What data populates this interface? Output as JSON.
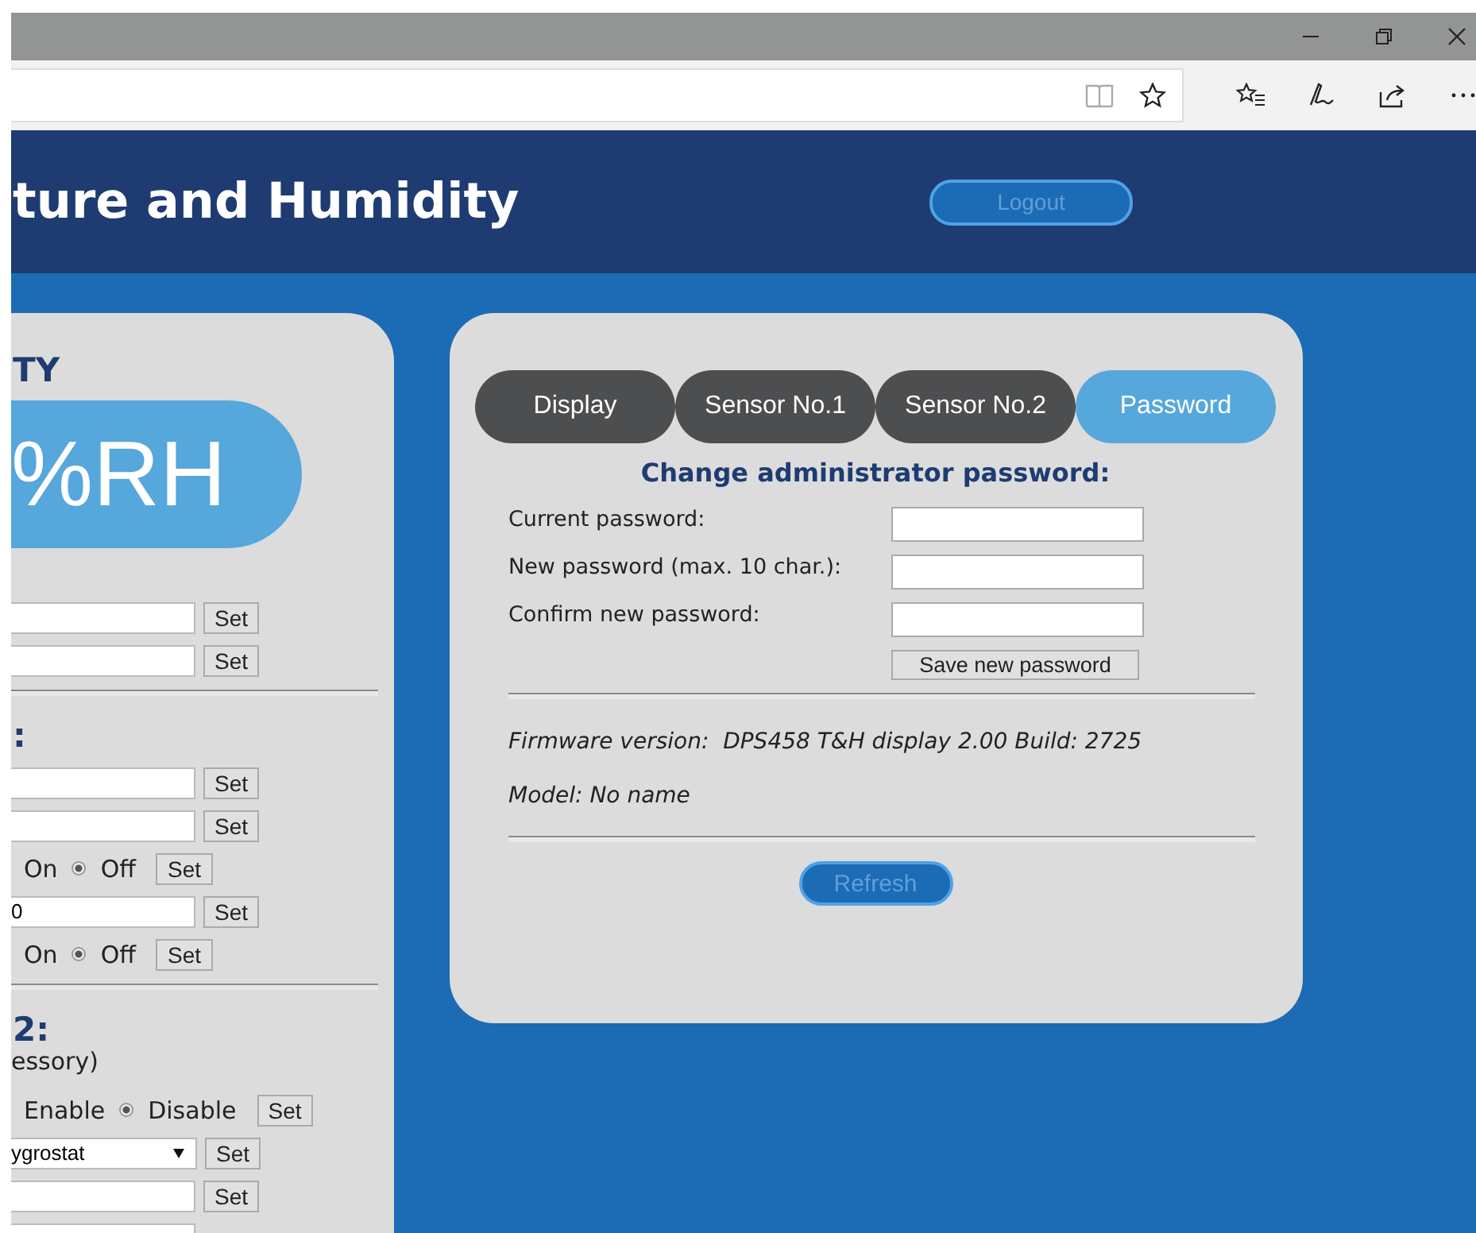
{
  "header": {
    "title": "ture and Humidity",
    "logout": "Logout"
  },
  "left_panel": {
    "rows": [
      {
        "kind": "heading",
        "text": "TY"
      },
      {
        "kind": "reading",
        "text": "%RH"
      },
      {
        "kind": "field",
        "button": "Set"
      },
      {
        "kind": "field",
        "button": "Set"
      },
      {
        "kind": "divider"
      },
      {
        "kind": "heading",
        "text": ":"
      },
      {
        "kind": "field",
        "button": "Set"
      },
      {
        "kind": "field",
        "button": "Set"
      },
      {
        "kind": "radio",
        "lead": "On",
        "option": "Off",
        "checked": true,
        "button": "Set"
      },
      {
        "kind": "field",
        "value": "0",
        "button": "Set"
      },
      {
        "kind": "radio",
        "lead": "On",
        "option": "Off",
        "checked": true,
        "button": "Set"
      },
      {
        "kind": "divider"
      },
      {
        "kind": "heading",
        "text": "2:"
      },
      {
        "kind": "note",
        "text": "essory)"
      },
      {
        "kind": "radio",
        "lead": "Enable",
        "option": "Disable",
        "checked": true,
        "button": "Set"
      },
      {
        "kind": "select",
        "value": "ygrostat",
        "button": "Set"
      },
      {
        "kind": "field",
        "button": "Set"
      },
      {
        "kind": "field"
      }
    ]
  },
  "tabs": [
    {
      "label": "Display",
      "selected": false
    },
    {
      "label": "Sensor No.1",
      "selected": false
    },
    {
      "label": "Sensor No.2",
      "selected": false
    },
    {
      "label": "Password",
      "selected": true
    }
  ],
  "password_form": {
    "heading": "Change administrator password:",
    "fields": [
      {
        "label": "Current password:"
      },
      {
        "label": "New password (max. 10 char.):"
      },
      {
        "label": "Confirm new password:"
      }
    ],
    "save_button": "Save new password"
  },
  "info": {
    "firmware_label": "Firmware version:",
    "firmware_value": "DPS458 T&H display 2.00 Build: 2725",
    "model": "Model: No name"
  },
  "refresh_button": "Refresh"
}
